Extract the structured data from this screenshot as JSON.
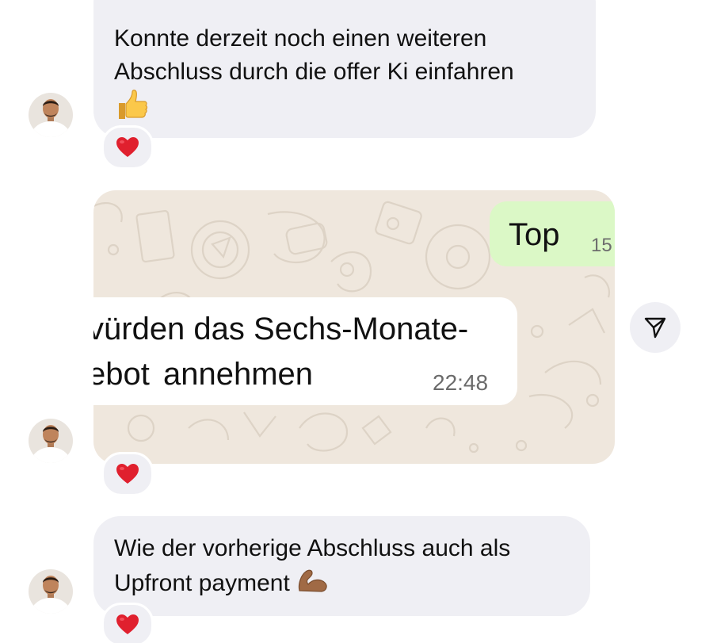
{
  "messages": [
    {
      "lines": [
        "Konnte derzeit noch einen weiteren",
        "Abschluss durch die offer Ki einfahren"
      ],
      "emoji": "thumbs-up",
      "reaction": "red-heart"
    },
    {
      "type": "shared-screenshot",
      "screenshot": {
        "sent_text": "Top",
        "sent_time": "15",
        "received_line1": "vürden das Sechs-Monate-",
        "received_line2": "ebot annehmen",
        "received_time": "22:48"
      },
      "reaction": "red-heart"
    },
    {
      "lines": [
        "Wie der vorherige Abschluss auch als",
        "Upfront payment"
      ],
      "emoji": "flexed-biceps",
      "reaction": "red-heart"
    }
  ],
  "actions": {
    "share_icon": "paper-plane-icon"
  },
  "colors": {
    "bubble_bg": "#efeff4",
    "sent_bubble": "#dbf8c6",
    "chat_wallpaper": "#efe7dd",
    "heart": "#e0202e"
  }
}
